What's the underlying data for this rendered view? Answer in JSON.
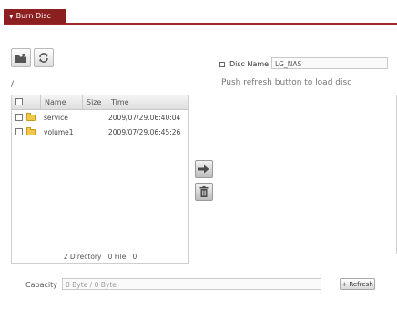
{
  "tab": {
    "label": "Burn Disc",
    "caret": "▼"
  },
  "toolbar": {
    "upload_icon": "folder-upload-icon",
    "refresh_icon": "refresh-arrows-icon"
  },
  "browser": {
    "path": "/",
    "columns": [
      "Name",
      "Size",
      "Time"
    ],
    "rows": [
      {
        "name": "service",
        "size": "",
        "time": "2009/07/29.06:40:04"
      },
      {
        "name": "volume1",
        "size": "",
        "time": "2009/07/29.06:45:26"
      }
    ],
    "status": "2 Directory   0 File   0"
  },
  "actions": {
    "add_icon": "arrow-right-icon",
    "delete_icon": "trash-icon"
  },
  "disc": {
    "name_label": "Disc Name",
    "name_value": "LG_NAS",
    "message": "Push refresh button to load disc"
  },
  "capacity": {
    "label": "Capacity",
    "value": "0 Byte / 0 Byte"
  },
  "refresh_button": {
    "label": "+ Refresh"
  },
  "colors": {
    "tab_bg": "#8c1f1f",
    "folder": "#f2c84b"
  }
}
